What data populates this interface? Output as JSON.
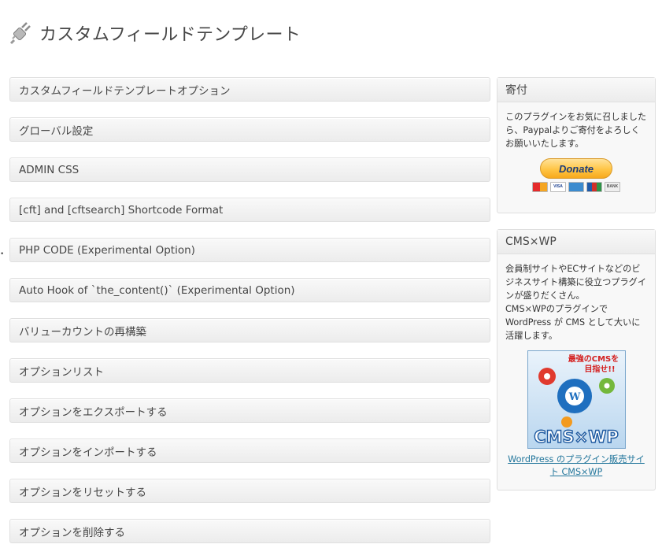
{
  "header": {
    "title": "カスタムフィールドテンプレート",
    "icon": "plugin-plug-icon"
  },
  "sections": [
    "カスタムフィールドテンプレートオプション",
    "グローバル設定",
    "ADMIN CSS",
    "[cft] and [cftsearch] Shortcode Format",
    "PHP CODE (Experimental Option)",
    "Auto Hook of `the_content()` (Experimental Option)",
    "バリューカウントの再構築",
    "オプションリスト",
    "オプションをエクスポートする",
    "オプションをインポートする",
    "オプションをリセットする",
    "オプションを削除する"
  ],
  "donate": {
    "heading": "寄付",
    "text": "このプラグインをお気に召しましたら、Paypalよりご寄付をよろしくお願いいたします。",
    "button_label": "Donate",
    "cards": [
      "MasterCard",
      "VISA",
      "AMEX",
      "JCB",
      "BANK"
    ]
  },
  "cms": {
    "heading": "CMS×WP",
    "text1": "会員制サイトやECサイトなどのビジネスサイト構築に役立つプラグインが盛りだくさん。",
    "text2": "CMS×WPのプラグインでWordPress が CMS として大いに活躍します。",
    "banner_top": "最強のCMSを",
    "banner_top2": "目指せ!!",
    "banner_logo": "CMS×WP",
    "link": "WordPress のプラグイン販売サイト CMS×WP"
  },
  "colors": {
    "link": "#21759b",
    "panel_border": "#dfdfdf",
    "title": "#464646",
    "donate_gold": "#ffc545",
    "banner_blue": "#1f6fbf"
  }
}
